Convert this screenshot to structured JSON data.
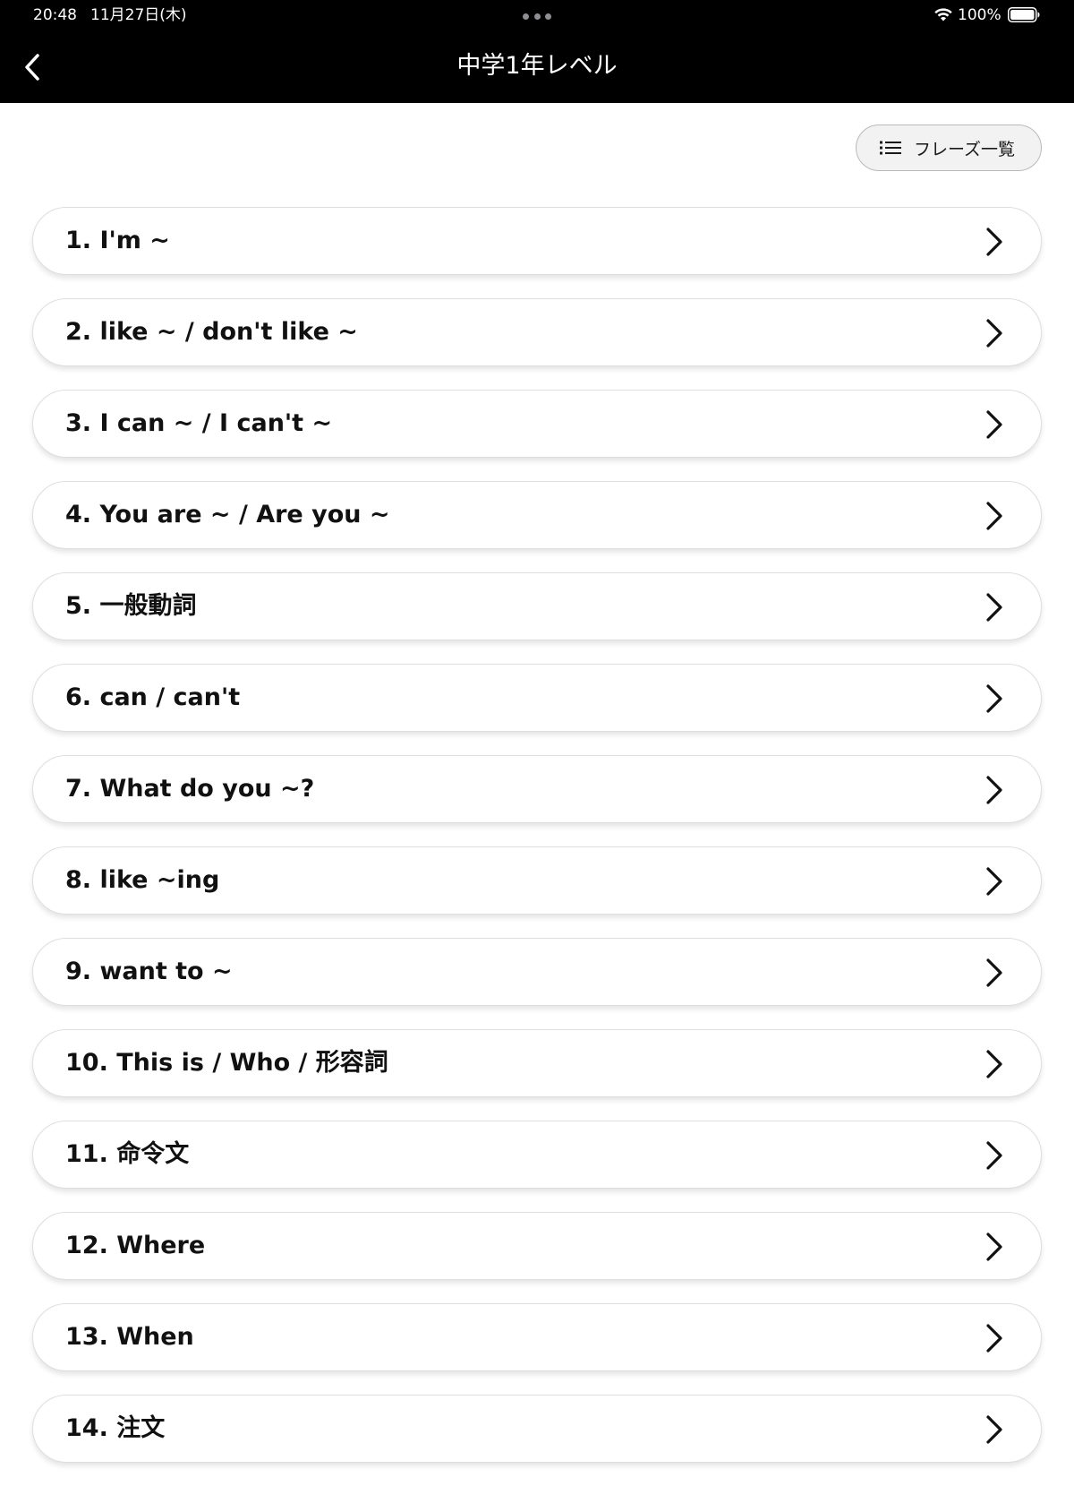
{
  "status_bar": {
    "time": "20:48",
    "date": "11月27日(木)",
    "battery": "100%"
  },
  "nav": {
    "title": "中学1年レベル"
  },
  "phrase_button": {
    "label": "フレーズ一覧",
    "icon": "list-icon"
  },
  "lessons": [
    {
      "label": "1. I'm ~"
    },
    {
      "label": "2. like ~ / don't like ~"
    },
    {
      "label": "3. I can ~ / I can't ~"
    },
    {
      "label": "4. You are ~ / Are you ~"
    },
    {
      "label": "5. 一般動詞"
    },
    {
      "label": "6. can / can't"
    },
    {
      "label": "7. What do you ~?"
    },
    {
      "label": "8. like ~ing"
    },
    {
      "label": "9. want to ~"
    },
    {
      "label": "10. This is / Who / 形容詞"
    },
    {
      "label": "11. 命令文"
    },
    {
      "label": "12. Where"
    },
    {
      "label": "13. When"
    },
    {
      "label": "14. 注文"
    }
  ],
  "colors": {
    "header_bg": "#000000",
    "page_bg": "#ffffff",
    "card_border": "#dedede",
    "button_bg": "#f2f2f2"
  }
}
